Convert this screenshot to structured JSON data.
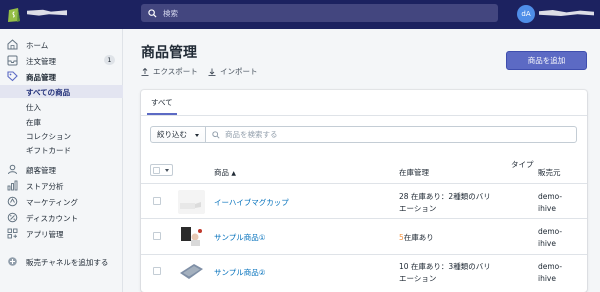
{
  "topbar": {
    "search_placeholder": "検索",
    "avatar_initials": "dA"
  },
  "sidebar": {
    "items": [
      {
        "label": "ホーム",
        "icon": "home-icon"
      },
      {
        "label": "注文管理",
        "icon": "orders-icon",
        "badge": "1"
      },
      {
        "label": "商品管理",
        "icon": "tag-icon",
        "active": true
      },
      {
        "label": "顧客管理",
        "icon": "customers-icon"
      },
      {
        "label": "ストア分析",
        "icon": "analytics-icon"
      },
      {
        "label": "マーケティング",
        "icon": "marketing-icon"
      },
      {
        "label": "ディスカウント",
        "icon": "discount-icon"
      },
      {
        "label": "アプリ管理",
        "icon": "apps-icon"
      }
    ],
    "sub_items": [
      {
        "label": "すべての商品",
        "selected": true
      },
      {
        "label": "仕入"
      },
      {
        "label": "在庫"
      },
      {
        "label": "コレクション"
      },
      {
        "label": "ギフトカード"
      }
    ],
    "add_channel": {
      "label": "販売チャネルを追加する",
      "icon": "plus-circle-icon"
    }
  },
  "page": {
    "title": "商品管理",
    "export_label": "エクスポート",
    "import_label": "インポート",
    "add_product_label": "商品を追加"
  },
  "card": {
    "tab_all": "すべて",
    "filter_label": "絞り込む",
    "search_placeholder": "商品を検索する",
    "columns": {
      "product": "商品",
      "inventory": "在庫管理",
      "type": "タイプ",
      "vendor": "販売元"
    },
    "rows": [
      {
        "name": "イーハイブマグカップ",
        "inventory_line1": "28 在庫あり：2種類のバリ",
        "inventory_line2": "エーション",
        "vendor_line1": "demo-",
        "vendor_line2": "ihive"
      },
      {
        "name": "サンプル商品①",
        "inventory_count": "5",
        "inventory_suffix": "在庫あり",
        "vendor_line1": "demo-",
        "vendor_line2": "ihive"
      },
      {
        "name": "サンプル商品②",
        "inventory_line1": "10 在庫あり：3種類のバリ",
        "inventory_line2": "エーション",
        "vendor_line1": "demo-",
        "vendor_line2": "ihive"
      }
    ]
  },
  "colors": {
    "topbar": "#1c2260",
    "primary": "#5c6ac4",
    "link": "#006fbb",
    "warning": "#f49342"
  }
}
